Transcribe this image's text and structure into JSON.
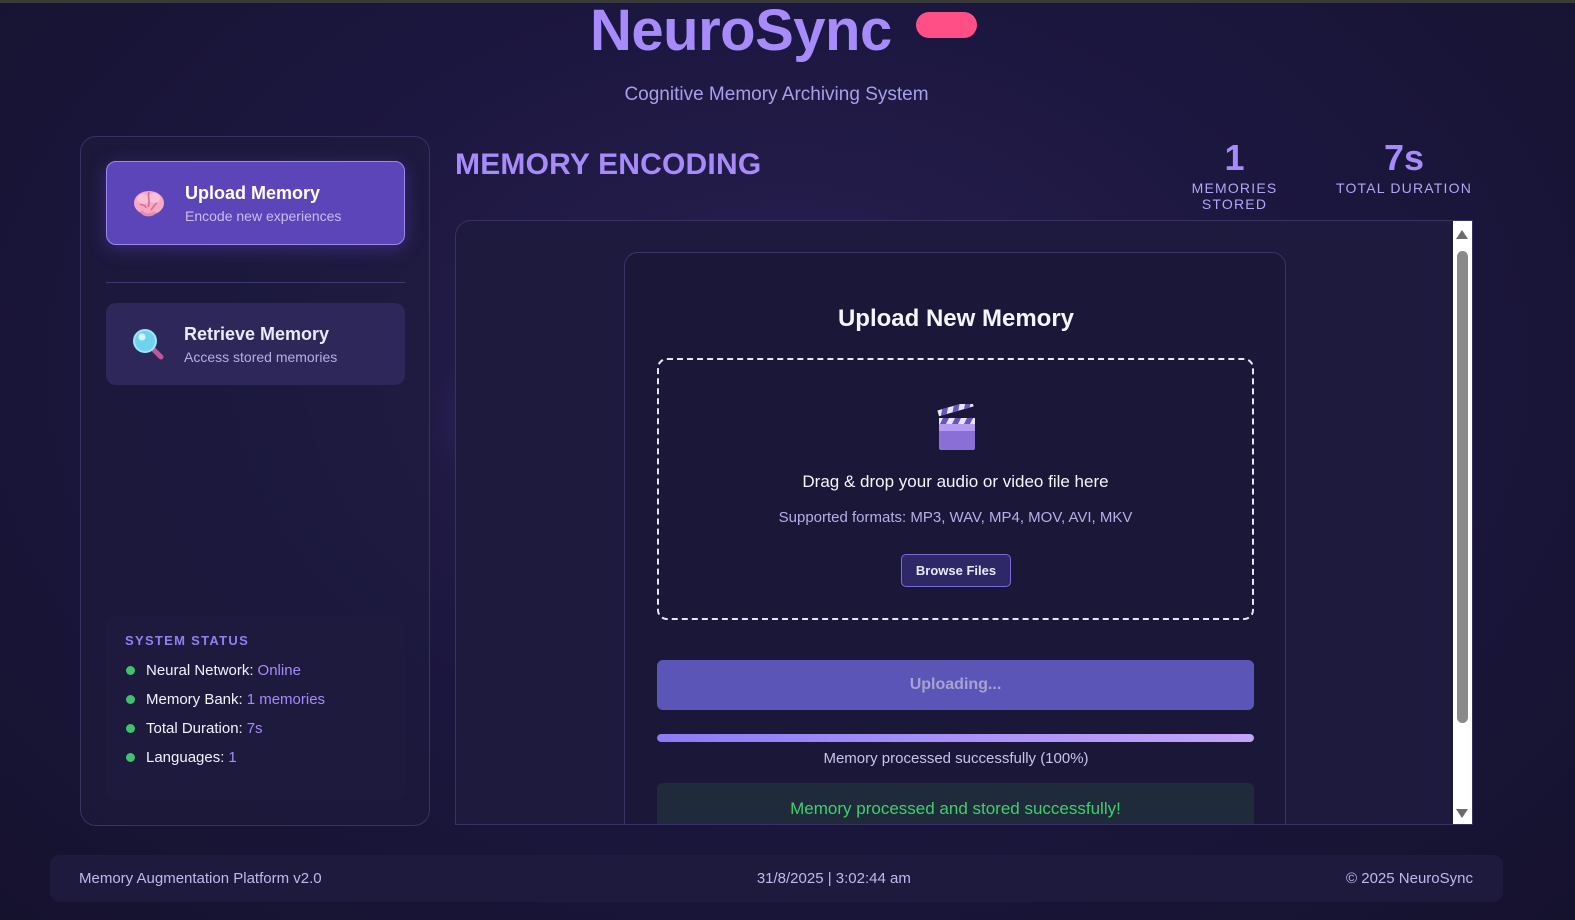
{
  "app": {
    "title": "NeuroSync",
    "subtitle": "Cognitive Memory Archiving System",
    "badge_color": "#ff4f86",
    "accent_color": "#a78bfa"
  },
  "sidebar": {
    "items": [
      {
        "label": "Upload Memory",
        "sublabel": "Encode new experiences",
        "icon": "brain-icon",
        "active": true
      },
      {
        "label": "Retrieve Memory",
        "sublabel": "Access stored memories",
        "icon": "magnifying-glass-icon",
        "active": false
      }
    ],
    "status": {
      "title": "SYSTEM STATUS",
      "rows": [
        {
          "label": "Neural Network:",
          "value": "Online"
        },
        {
          "label": "Memory Bank:",
          "value": "1 memories"
        },
        {
          "label": "Total Duration:",
          "value": "7s"
        },
        {
          "label": "Languages:",
          "value": "1"
        }
      ],
      "indicator_color": "#3fc26a"
    }
  },
  "main": {
    "title": "MEMORY ENCODING",
    "stats": [
      {
        "value": "1",
        "label": "MEMORIES STORED"
      },
      {
        "value": "7s",
        "label": "TOTAL DURATION"
      }
    ]
  },
  "upload": {
    "title": "Upload New Memory",
    "dropzone_icon": "clapperboard-icon",
    "dropzone_text": "Drag & drop your audio or video file here",
    "formats_text": "Supported formats: MP3, WAV, MP4, MOV, AVI, MKV",
    "browse_label": "Browse Files",
    "upload_button_label": "Uploading...",
    "progress_percent": 100,
    "progress_text": "Memory processed successfully (100%)",
    "success_text": "Memory processed and stored successfully!",
    "success_color": "#3fd06b"
  },
  "footer": {
    "left": "Memory Augmentation Platform v2.0",
    "center": "31/8/2025 | 3:02:44 am",
    "right": "© 2025 NeuroSync"
  }
}
